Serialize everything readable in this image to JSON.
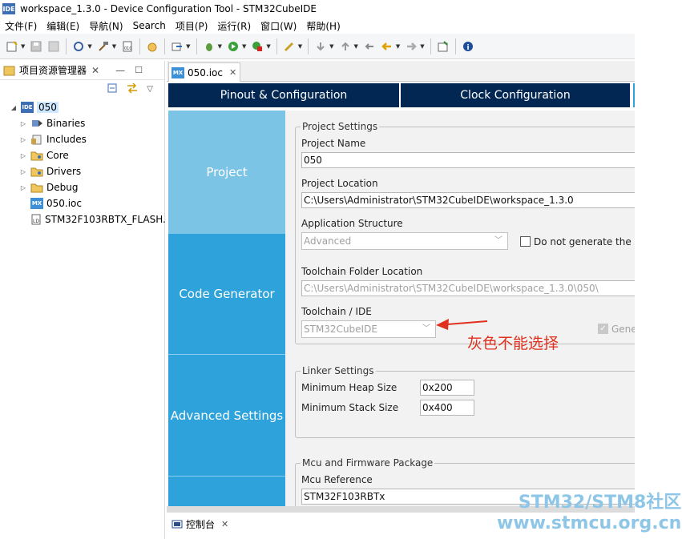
{
  "window": {
    "title": "workspace_1.3.0 - Device Configuration Tool - STM32CubeIDE",
    "icon": "ide-icon"
  },
  "menu": [
    "文件(F)",
    "编辑(E)",
    "导航(N)",
    "Search",
    "项目(P)",
    "运行(R)",
    "窗口(W)",
    "帮助(H)"
  ],
  "explorer": {
    "title": "项目资源管理器",
    "project": "050",
    "items": [
      {
        "label": "Binaries",
        "icon": "binaries-icon"
      },
      {
        "label": "Includes",
        "icon": "includes-icon"
      },
      {
        "label": "Core",
        "icon": "folder-icon"
      },
      {
        "label": "Drivers",
        "icon": "folder-icon"
      },
      {
        "label": "Debug",
        "icon": "folder-icon"
      },
      {
        "label": "050.ioc",
        "icon": "mx-file-icon"
      },
      {
        "label": "STM32F103RBTX_FLASH.",
        "icon": "linker-file-icon"
      }
    ]
  },
  "editor": {
    "tab": "050.ioc",
    "top_tabs": [
      "Pinout & Configuration",
      "Clock Configuration"
    ],
    "side_tabs": [
      "Project",
      "Code Generator",
      "Advanced Settings"
    ],
    "project_settings": {
      "legend": "Project Settings",
      "name_label": "Project Name",
      "name_value": "050",
      "location_label": "Project Location",
      "location_value": "C:\\Users\\Administrator\\STM32CubeIDE\\workspace_1.3.0",
      "app_structure_label": "Application Structure",
      "app_structure_value": "Advanced",
      "do_not_generate_label": "Do not generate the m",
      "toolchain_folder_label": "Toolchain Folder Location",
      "toolchain_folder_value": "C:\\Users\\Administrator\\STM32CubeIDE\\workspace_1.3.0\\050\\",
      "toolchain_ide_label": "Toolchain / IDE",
      "toolchain_ide_value": "STM32CubeIDE",
      "generate_label": "Gene"
    },
    "linker_settings": {
      "legend": "Linker Settings",
      "heap_label": "Minimum Heap Size",
      "heap_value": "0x200",
      "stack_label": "Minimum Stack Size",
      "stack_value": "0x400"
    },
    "mcu_package": {
      "legend": "Mcu and Firmware Package",
      "ref_label": "Mcu Reference",
      "ref_value": "STM32F103RBTx"
    }
  },
  "console": {
    "title": "控制台"
  },
  "annotation": "灰色不能选择",
  "watermark": {
    "line1": "STM32/STM8社区",
    "line2": "www.stmcu.org.cn"
  },
  "colors": {
    "top_tab": "#022752",
    "side_tab_active": "#7cc4e6",
    "side_tab": "#2ea2da",
    "annotation": "#e0301e"
  }
}
